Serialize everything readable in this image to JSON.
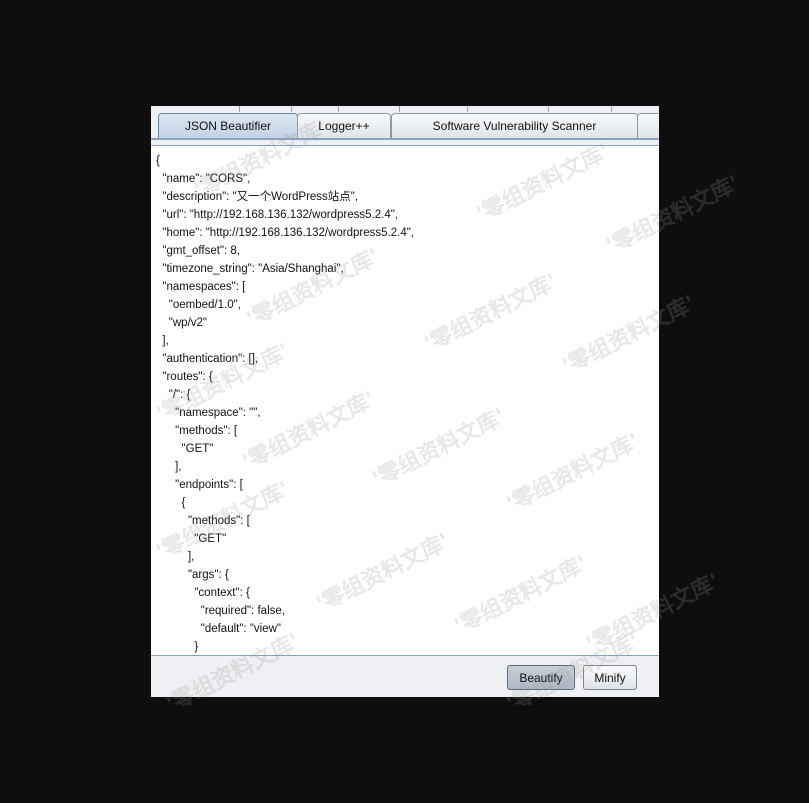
{
  "tabs": [
    {
      "label": "JSON Beautifier",
      "active": true
    },
    {
      "label": "Logger++",
      "active": false
    },
    {
      "label": "Software Vulnerability Scanner",
      "active": false
    },
    {
      "label": "",
      "active": false
    }
  ],
  "editor": {
    "content": "{\n  \"name\": \"CORS\",\n  \"description\": \"又一个WordPress站点\",\n  \"url\": \"http://192.168.136.132/wordpress5.2.4\",\n  \"home\": \"http://192.168.136.132/wordpress5.2.4\",\n  \"gmt_offset\": 8,\n  \"timezone_string\": \"Asia/Shanghai\",\n  \"namespaces\": [\n    \"oembed/1.0\",\n    \"wp/v2\"\n  ],\n  \"authentication\": [],\n  \"routes\": {\n    \"/\": {\n      \"namespace\": \"\",\n      \"methods\": [\n        \"GET\"\n      ],\n      \"endpoints\": [\n        {\n          \"methods\": [\n            \"GET\"\n          ],\n          \"args\": {\n            \"context\": {\n              \"required\": false,\n              \"default\": \"view\"\n            }"
  },
  "buttons": {
    "beautify": "Beautify",
    "minify": "Minify"
  },
  "watermark": {
    "text": "'零组资料文库'"
  },
  "colors": {
    "background": "#0e0e0e",
    "panel": "#eef0f3",
    "active_tab": "#c2d3e4",
    "accent_rule": "#8aa2bd"
  }
}
